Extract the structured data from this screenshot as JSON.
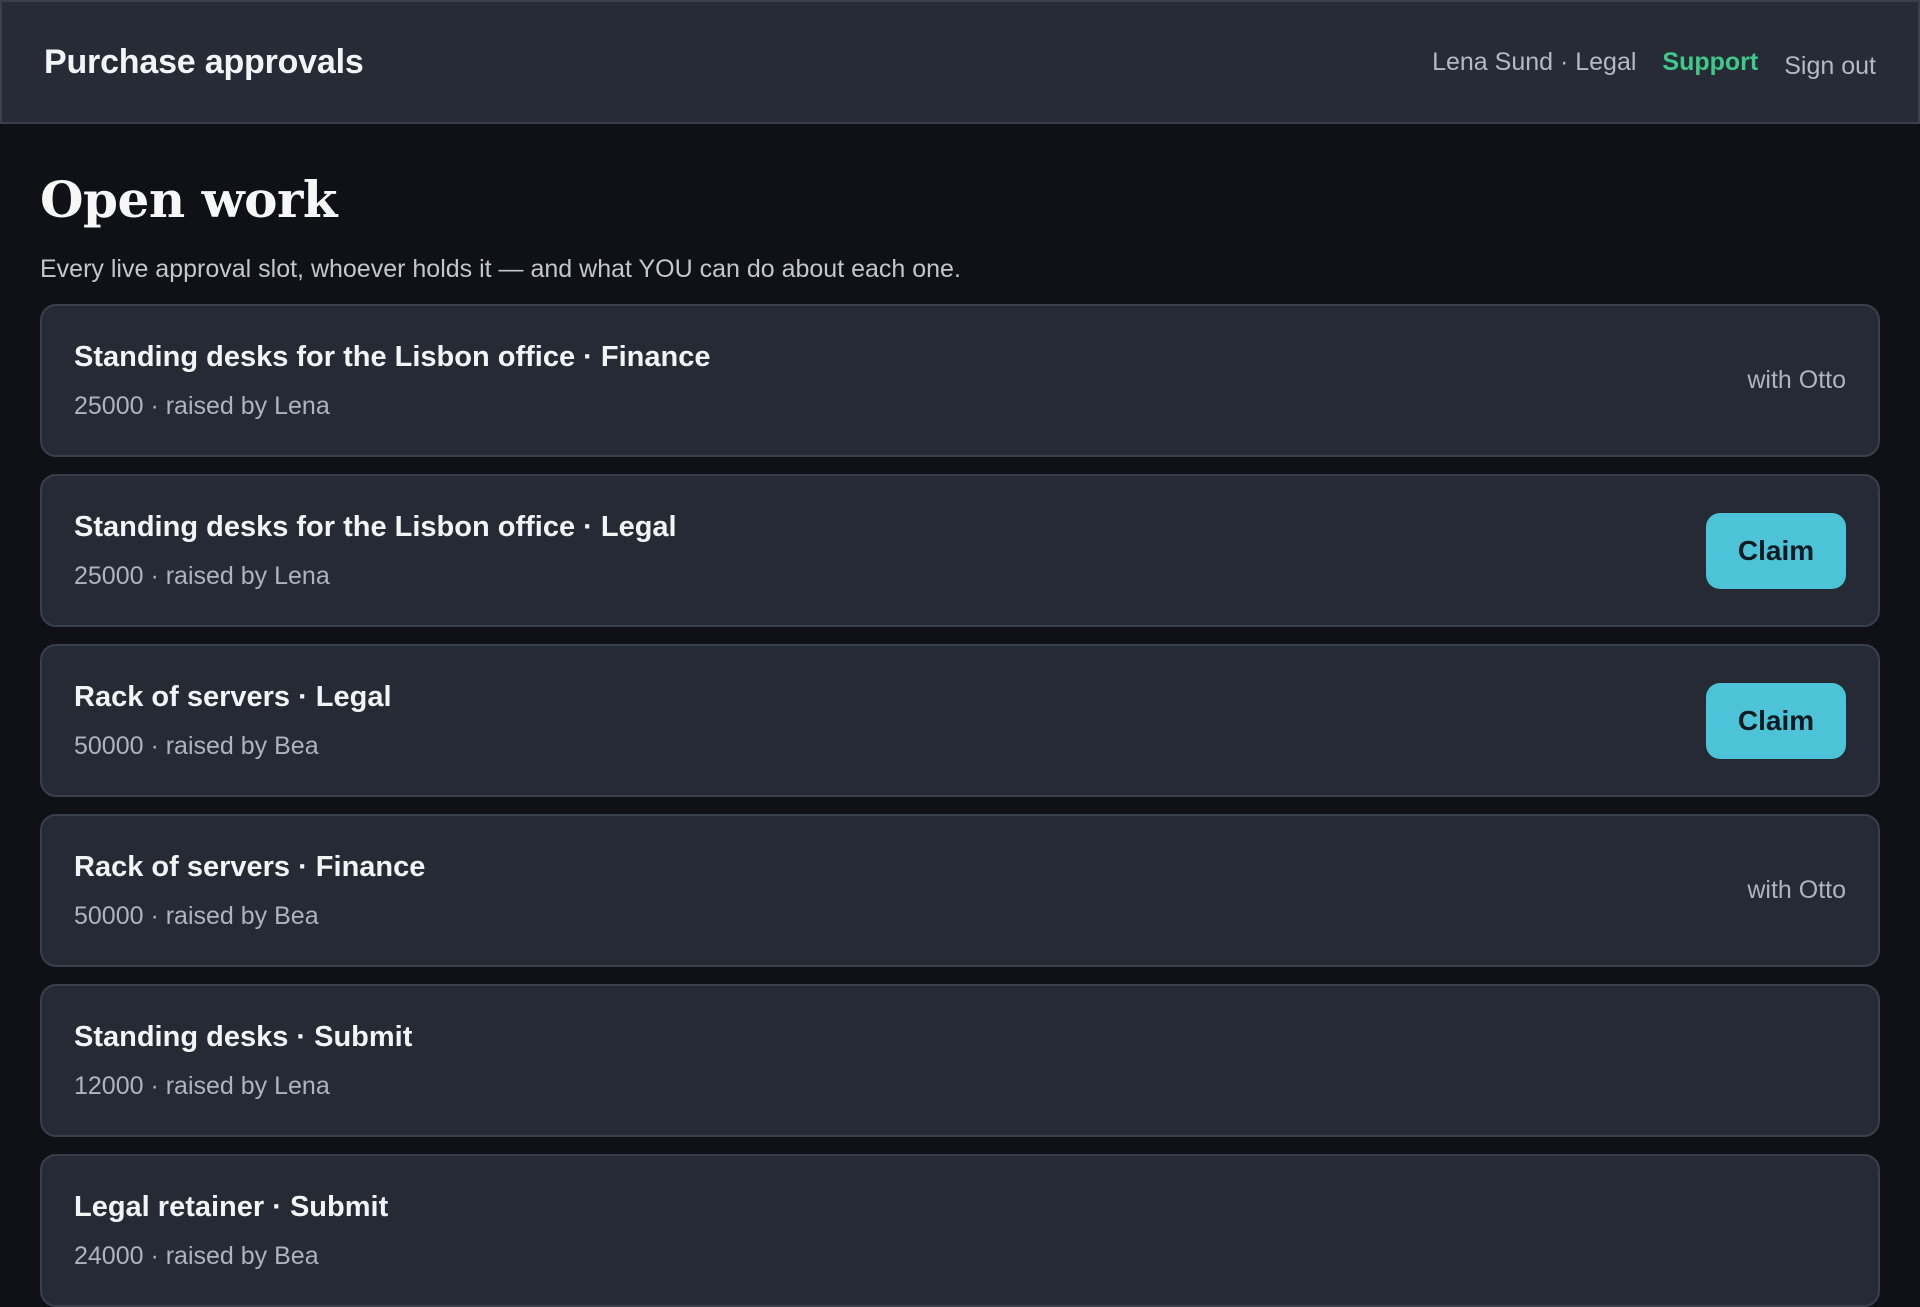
{
  "header": {
    "title": "Purchase approvals",
    "user": "Lena Sund · Legal",
    "support_label": "Support",
    "signout_label": "Sign out"
  },
  "page": {
    "title": "Open work",
    "subtitle": "Every live approval slot, whoever holds it — and what YOU can do about each one."
  },
  "items": [
    {
      "title": "Standing desks for the Lisbon office · Finance",
      "meta": "25000 · raised by Lena",
      "status": "with Otto",
      "action": ""
    },
    {
      "title": "Standing desks for the Lisbon office · Legal",
      "meta": "25000 · raised by Lena",
      "status": "",
      "action": "Claim"
    },
    {
      "title": "Rack of servers · Legal",
      "meta": "50000 · raised by Bea",
      "status": "",
      "action": "Claim"
    },
    {
      "title": "Rack of servers · Finance",
      "meta": "50000 · raised by Bea",
      "status": "with Otto",
      "action": ""
    },
    {
      "title": "Standing desks · Submit",
      "meta": "12000 · raised by Lena",
      "status": "",
      "action": ""
    },
    {
      "title": "Legal retainer · Submit",
      "meta": "24000 · raised by Bea",
      "status": "",
      "action": ""
    }
  ],
  "colors": {
    "accent": "#4cc3d6",
    "support": "#3fc98a",
    "background": "#0f1116",
    "card": "#262a35"
  }
}
